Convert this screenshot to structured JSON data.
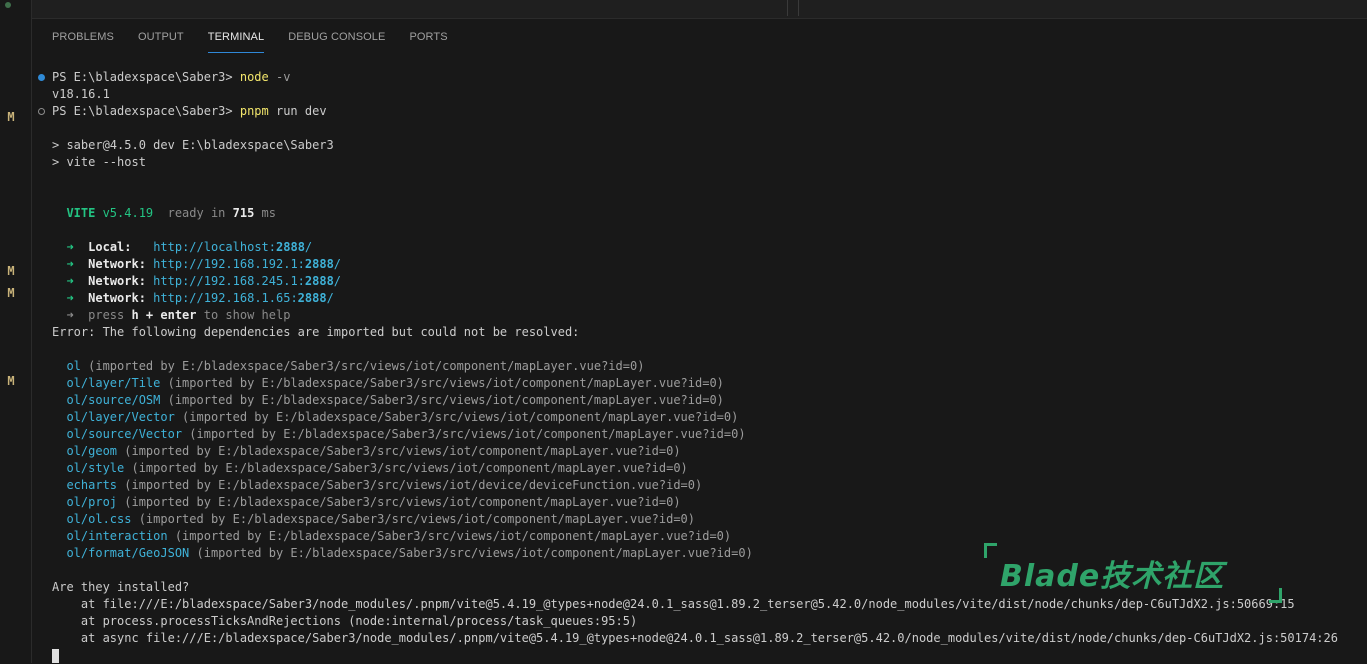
{
  "gutter": {
    "markers": [
      "M",
      "M",
      "M",
      "M"
    ]
  },
  "panel": {
    "tabs": [
      "PROBLEMS",
      "OUTPUT",
      "TERMINAL",
      "DEBUG CONSOLE",
      "PORTS"
    ],
    "active_tab": "TERMINAL"
  },
  "terminal": {
    "prompt1": "PS E:\\bladexspace\\Saber3> ",
    "cmd1_name": "node",
    "cmd1_args": " -v",
    "out_version": "v18.16.1",
    "prompt2": "PS E:\\bladexspace\\Saber3> ",
    "cmd2_name": "pnpm",
    "cmd2_args": " run dev",
    "script_line1": "> saber@4.5.0 dev E:\\bladexspace\\Saber3",
    "script_line2": "> vite --host",
    "vite": {
      "name": "VITE",
      "version": " v5.4.19",
      "ready": "  ready in ",
      "ms": "715",
      "unit": " ms"
    },
    "urls": [
      {
        "label": "Local:",
        "pad": "   ",
        "prefix": "http://localhost:",
        "port": "2888",
        "suffix": "/"
      },
      {
        "label": "Network:",
        "pad": " ",
        "prefix": "http://192.168.192.1:",
        "port": "2888",
        "suffix": "/"
      },
      {
        "label": "Network:",
        "pad": " ",
        "prefix": "http://192.168.245.1:",
        "port": "2888",
        "suffix": "/"
      },
      {
        "label": "Network:",
        "pad": " ",
        "prefix": "http://192.168.1.65:",
        "port": "2888",
        "suffix": "/"
      }
    ],
    "help": {
      "arrow": "➜",
      "pre": "  press ",
      "key": "h + enter",
      "post": " to show help"
    },
    "error_line": "Error: The following dependencies are imported but could not be resolved:",
    "deps": [
      {
        "name": "ol",
        "src": " (imported by E:/bladexspace/Saber3/src/views/iot/component/mapLayer.vue?id=0)"
      },
      {
        "name": "ol/layer/Tile",
        "src": " (imported by E:/bladexspace/Saber3/src/views/iot/component/mapLayer.vue?id=0)"
      },
      {
        "name": "ol/source/OSM",
        "src": " (imported by E:/bladexspace/Saber3/src/views/iot/component/mapLayer.vue?id=0)"
      },
      {
        "name": "ol/layer/Vector",
        "src": " (imported by E:/bladexspace/Saber3/src/views/iot/component/mapLayer.vue?id=0)"
      },
      {
        "name": "ol/source/Vector",
        "src": " (imported by E:/bladexspace/Saber3/src/views/iot/component/mapLayer.vue?id=0)"
      },
      {
        "name": "ol/geom",
        "src": " (imported by E:/bladexspace/Saber3/src/views/iot/component/mapLayer.vue?id=0)"
      },
      {
        "name": "ol/style",
        "src": " (imported by E:/bladexspace/Saber3/src/views/iot/component/mapLayer.vue?id=0)"
      },
      {
        "name": "echarts",
        "src": " (imported by E:/bladexspace/Saber3/src/views/iot/device/deviceFunction.vue?id=0)"
      },
      {
        "name": "ol/proj",
        "src": " (imported by E:/bladexspace/Saber3/src/views/iot/component/mapLayer.vue?id=0)"
      },
      {
        "name": "ol/ol.css",
        "src": " (imported by E:/bladexspace/Saber3/src/views/iot/component/mapLayer.vue?id=0)"
      },
      {
        "name": "ol/interaction",
        "src": " (imported by E:/bladexspace/Saber3/src/views/iot/component/mapLayer.vue?id=0)"
      },
      {
        "name": "ol/format/GeoJSON",
        "src": " (imported by E:/bladexspace/Saber3/src/views/iot/component/mapLayer.vue?id=0)"
      }
    ],
    "question": "Are they installed?",
    "stack": [
      "    at file:///E:/bladexspace/Saber3/node_modules/.pnpm/vite@5.4.19_@types+node@24.0.1_sass@1.89.2_terser@5.42.0/node_modules/vite/dist/node/chunks/dep-C6uTJdX2.js:50669:15",
      "    at process.processTicksAndRejections (node:internal/process/task_queues:95:5)",
      "    at async file:///E:/bladexspace/Saber3/node_modules/.pnpm/vite@5.4.19_@types+node@24.0.1_sass@1.89.2_terser@5.42.0/node_modules/vite/dist/node/chunks/dep-C6uTJdX2.js:50174:26"
    ]
  },
  "watermark": {
    "text": "Blade技术社区",
    "color": "#2fa46a"
  }
}
